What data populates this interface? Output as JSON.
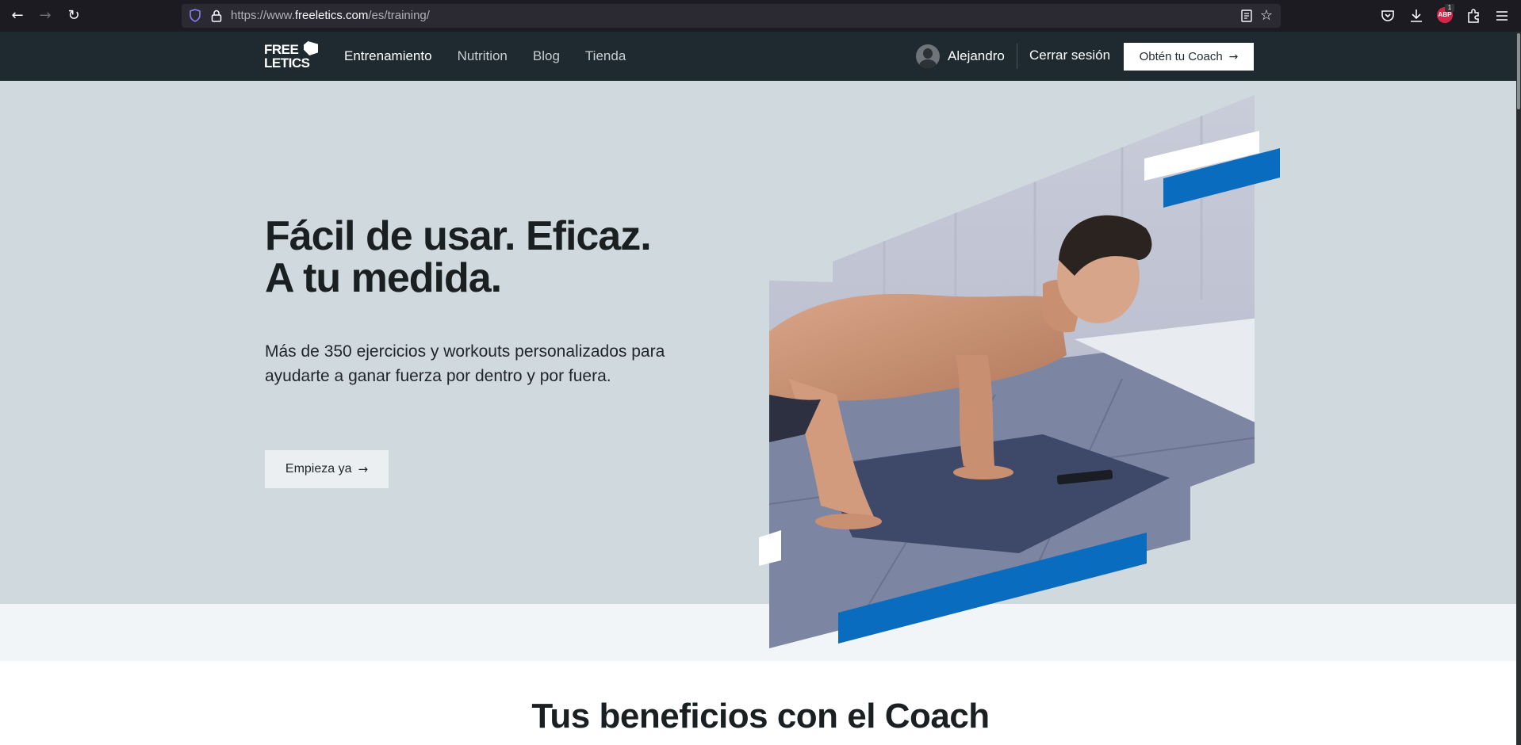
{
  "browser": {
    "url_prefix": "https://www.",
    "url_host": "freeletics.com",
    "url_path": "/es/training/",
    "adblock_count": "1",
    "adblock_label": "ABP"
  },
  "header": {
    "logo_line1": "FREE",
    "logo_line2": "LETICS",
    "nav": [
      "Entrenamiento",
      "Nutrition",
      "Blog",
      "Tienda"
    ],
    "user_name": "Alejandro",
    "logout": "Cerrar sesión",
    "coach_button": "Obtén tu Coach",
    "arrow": "→"
  },
  "hero": {
    "headline_line1": "Fácil de usar. Eficaz.",
    "headline_line2": "A tu medida.",
    "lead": "Más de 350 ejercicios y workouts personalizados para ayudarte a ganar fuerza por dentro y por fuera.",
    "cta": "Empieza ya",
    "arrow": "→"
  },
  "benefits": {
    "title": "Tus beneficios con el Coach"
  },
  "colors": {
    "header_bg": "#1f2a30",
    "hero_bg": "#d0d9de",
    "accent_blue": "#0a6cbf"
  }
}
